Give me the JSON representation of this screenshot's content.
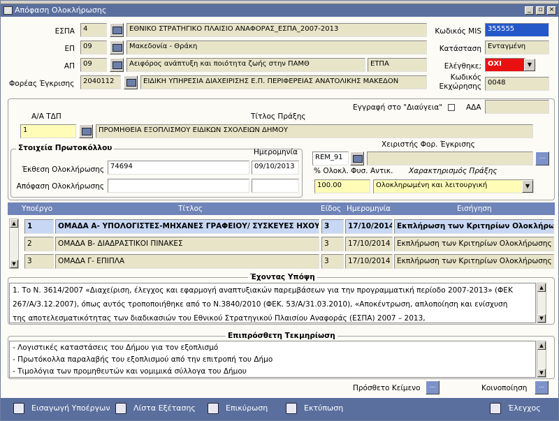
{
  "window": {
    "title": "Απόφαση Ολοκλήρωσης"
  },
  "header": {
    "espa_label": "ΕΣΠΑ",
    "espa_code": "4",
    "espa_name": "ΕΘΝΙΚΟ ΣΤΡΑΤΗΓΙΚΟ ΠΛΑΙΣΙΟ ΑΝΑΦΟΡΑΣ_ΕΣΠΑ_2007-2013",
    "ep_label": "ΕΠ",
    "ep_code": "09",
    "ep_name": "Μακεδονία - Θράκη",
    "ap_label": "ΑΠ",
    "ap_code": "09",
    "ap_name": "Αειφόρος ανάπτυξη και ποιότητα ζωής στην ΠΑΜΘ",
    "ap_fund": "ΕΤΠΑ",
    "foreas_label": "Φορέας Έγκρισης",
    "foreas_code": "2040112",
    "foreas_name": "ΕΙΔΙΚΗ ΥΠΗΡΕΣΙΑ ΔΙΑΧΕΙΡΙΣΗΣ Ε.Π. ΠΕΡΙΦΕΡΕΙΑΣ ΑΝΑΤΟΛΙΚΗΣ ΜΑΚΕΔΟΝ",
    "mis_label": "Κωδικός MIS",
    "mis_value": "355555",
    "status_label": "Κατάσταση",
    "status_value": "Ενταγμένη",
    "checked_label": "Ελέγθηκε;",
    "checked_value": "ΟΧΙ",
    "release_label": "Κωδικός Εκχώρησης",
    "release_value": "0048"
  },
  "act": {
    "aa_label": "Α/Α ΤΔΠ",
    "title_label": "Τίτλος Πράξης",
    "aa_value": "1",
    "title_value": "ΠΡΟΜΗΘΕΙΑ ΕΞΟΠΛΙΣΜΟΥ ΕΙΔΙΚΩΝ ΣΧΟΛΕΙΩΝ ΔΗΜΟΥ",
    "diavgeia_label": "Εγγραφή στο \"Διαύγεια\"",
    "ada_label": "ΑΔΑ",
    "ada_value": ""
  },
  "protocol": {
    "frame_title": "Στοιχεία Πρωτοκόλλου",
    "date_label": "Ημερομηνία",
    "report_label": "Έκθεση Ολοκλήρωσης",
    "report_number": "74694",
    "report_date": "09/10/2013",
    "decision_label": "Απόφαση Ολοκλήρωσης",
    "decision_number": "",
    "decision_date": ""
  },
  "handler": {
    "label": "Χειριστής Φορ. Έγκρισης",
    "code": "REM_91",
    "name": "",
    "completion_label": "% Ολοκλ. Φυσ. Αντικ.",
    "completion_value": "100.00",
    "character_label": "Χαρακτηρισμός Πράξης",
    "character_value": "Ολοκληρωμένη και λειτουργική"
  },
  "grid": {
    "headers": {
      "sub": "Υποέργο",
      "title": "Τίτλος",
      "kind": "Είδος",
      "date": "Ημερομηνία",
      "proposal": "Εισήγηση"
    },
    "rows": [
      {
        "aa": "1",
        "title": "ΟΜΑΔΑ Α- ΥΠΟΛΟΓΙΣΤΕΣ-ΜΗΧΑΝΕΣ ΓΡΑΦΕΙΟΥ/ ΣΥΣΚΕΥΕΣ ΗΧΟΥ",
        "kind": "3",
        "date": "17/10/2014",
        "proposal": "Εκπλήρωση των Κριτηρίων Ολοκλήρωσ"
      },
      {
        "aa": "2",
        "title": "ΟΜΑΔΑ Β- ΔΙΑΔΡΑΣΤΙΚΟΙ ΠΙΝΑΚΕΣ",
        "kind": "3",
        "date": "17/10/2014",
        "proposal": "Εκπλήρωση των Κριτηρίων Ολοκλήρωσης"
      },
      {
        "aa": "3",
        "title": "ΟΜΑΔΑ Γ- ΕΠΙΠΛΑ",
        "kind": "3",
        "date": "17/10/2014",
        "proposal": "Εκπλήρωση των Κριτηρίων Ολοκλήρωσης"
      }
    ]
  },
  "considering": {
    "title": "Έχοντας Υπόψη",
    "lines": [
      "1.     Το Ν. 3614/2007 «Διαχείριση, έλεγχος και εφαρμογή αναπτυξιακών παρεμβάσεων για την προγραμματική περίοδο 2007-2013» (ΦΕΚ",
      "267/Α/3.12.2007), όπως αυτός τροποποιήθηκε από το Ν.3840/2010 (ΦΕΚ. 53/Α/31.03.2010), «Αποκέντρωση, απλοποίηση και ενίσχυση",
      "της αποτελεσματικότητας των διαδικασιών του Εθνικού Στρατηγικού Πλαισίου Αναφοράς (ΕΣΠΑ) 2007 – 2013,"
    ]
  },
  "documentation": {
    "title": "Επιπρόσθετη Τεκμηρίωση",
    "lines": [
      "- Λογιστικές καταστάσεις του Δήμου για τον εξοπλισμό",
      "- Πρωτόκολλα παραλαβής του εξοπλισμού από την επιτροπή του Δήμο",
      "- Τιμολόγια των προμηθευτών και νομιμικά σύλλογα του Δήμου"
    ]
  },
  "extra": {
    "additional_text_label": "Πρόσθετο Κείμενο",
    "notification_label": "Κοινοποίηση",
    "dots": "..."
  },
  "footer": {
    "insert_sub": "Εισαγωγή Υποέργων",
    "list_exam": "Λίστα Εξέτασης",
    "validation": "Επικύρωση",
    "print": "Εκτύπωση",
    "check": "Έλεγχος"
  }
}
